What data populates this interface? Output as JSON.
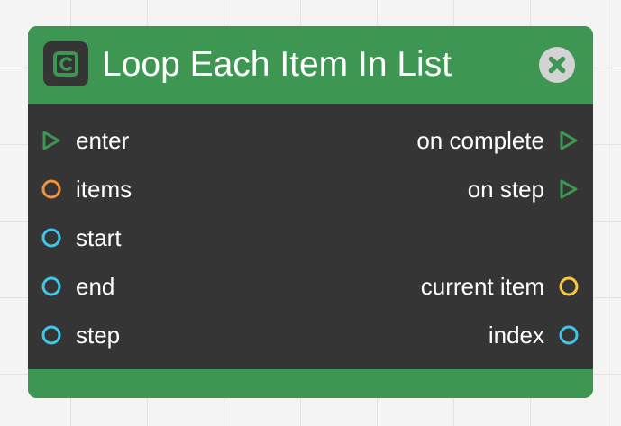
{
  "node": {
    "title": "Loop Each Item In List",
    "icon": "loop-c-icon",
    "close_icon": "close-x-icon",
    "colors": {
      "header": "#3d9651",
      "body": "#353535",
      "exec_port": "#3d9651",
      "items_port": "#f0923e",
      "number_port": "#3ec7e8",
      "current_item_port": "#f5c842"
    },
    "inputs": [
      {
        "label": "enter",
        "type": "exec"
      },
      {
        "label": "items",
        "type": "list"
      },
      {
        "label": "start",
        "type": "number"
      },
      {
        "label": "end",
        "type": "number"
      },
      {
        "label": "step",
        "type": "number"
      }
    ],
    "outputs": [
      {
        "label": "on complete",
        "type": "exec"
      },
      {
        "label": "on step",
        "type": "exec"
      },
      {
        "label": "current item",
        "type": "any"
      },
      {
        "label": "index",
        "type": "number"
      }
    ]
  }
}
